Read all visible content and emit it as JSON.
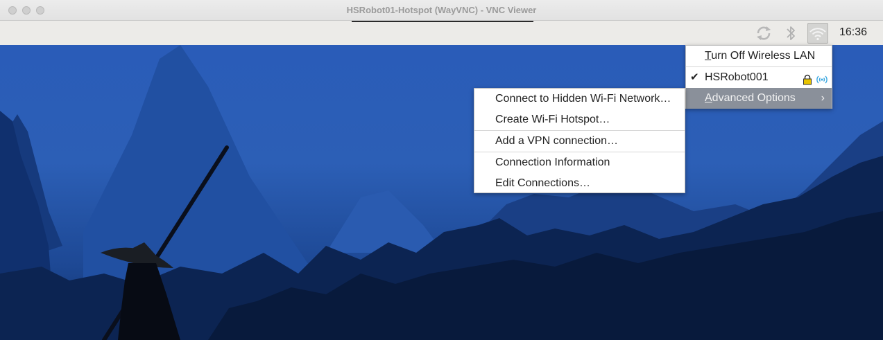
{
  "window": {
    "title": "HSRobot01-Hotspot (WayVNC) - VNC Viewer"
  },
  "panel": {
    "clock": "16:36",
    "tray": [
      "sync-icon",
      "bluetooth-icon",
      "wifi-icon"
    ]
  },
  "network_menu": {
    "turn_off_wifi": {
      "underline": "T",
      "rest": "urn Off Wireless LAN"
    },
    "network": {
      "name": "HSRobot001",
      "connected": true,
      "secured": true
    },
    "advanced": {
      "underline": "A",
      "rest": "dvanced Options"
    }
  },
  "advanced_menu": {
    "items": [
      "Connect to Hidden Wi-Fi Network…",
      "Create Wi-Fi Hotspot…",
      "Add a VPN connection…",
      "Connection Information",
      "Edit Connections…"
    ]
  },
  "colors": {
    "selection": "#8a909a",
    "wifi_signal": "#3aa7e0",
    "lock": "#e8c400"
  }
}
